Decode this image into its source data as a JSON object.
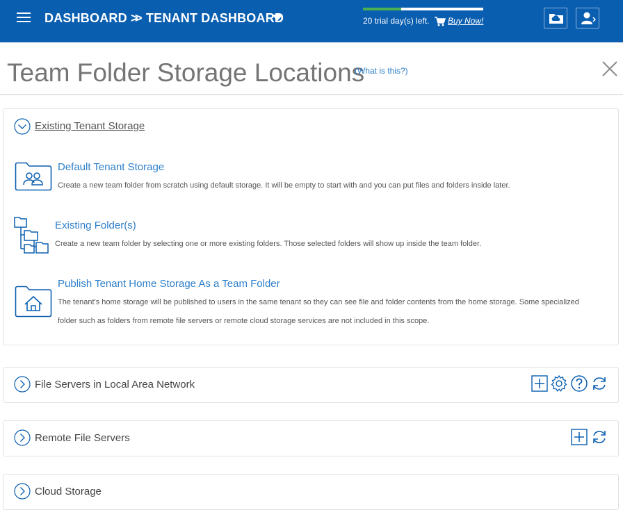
{
  "header": {
    "breadcrumb_1": "DASHBOARD >",
    "breadcrumb_2": "> TENANT DASHBOARD",
    "trial_text": "20 trial day(s) left.",
    "buy_now": "Buy Now!",
    "trial_progress_fraction": 0.32,
    "colors": {
      "bar": "#0a5eb0",
      "progress": "#4caf50"
    }
  },
  "page": {
    "title": "Team Folder Storage Locations",
    "what_is_this": "(What is this?)"
  },
  "existing_storage": {
    "heading": "Existing Tenant Storage",
    "options": [
      {
        "title": "Default Tenant Storage",
        "description": "Create a new team folder from scratch using default storage. It will be empty to start with and you can put files and folders inside later.",
        "icon": "folder-users-icon"
      },
      {
        "title": "Existing Folder(s)",
        "description": "Create a new team folder by selecting one or more existing folders. Those selected folders will show up inside the team folder.",
        "icon": "folder-tree-icon"
      },
      {
        "title": "Publish Tenant Home Storage As a Team Folder",
        "description_line1": "The tenant's home storage will be published to users in the same tenant so they can see file and folder contents from the home storage. Some specialized",
        "description_line2": "folder such as folders from remote file servers or remote cloud storage services are not included in this scope.",
        "icon": "folder-home-icon"
      }
    ]
  },
  "sections": [
    {
      "title": "File Servers in Local Area Network",
      "tools": [
        "add-icon",
        "settings-icon",
        "help-icon",
        "refresh-icon"
      ]
    },
    {
      "title": "Remote File Servers",
      "tools": [
        "add-icon",
        "refresh-icon"
      ]
    },
    {
      "title": "Cloud Storage",
      "tools": []
    }
  ],
  "accent_color": "#2e7fc9"
}
